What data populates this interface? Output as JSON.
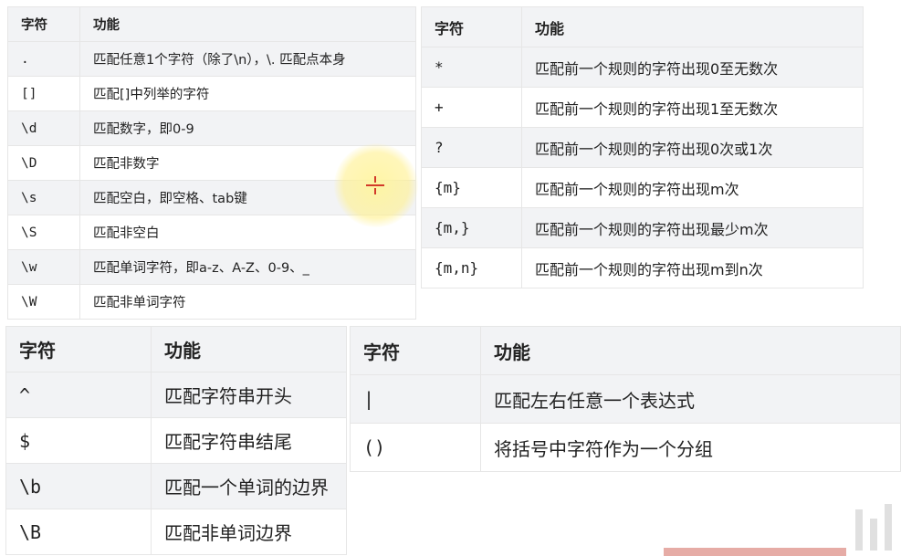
{
  "table_a": {
    "headers": [
      "字符",
      "功能"
    ],
    "rows": [
      {
        "sym": ".",
        "desc": "匹配任意1个字符（除了\\n），\\. 匹配点本身"
      },
      {
        "sym": "[]",
        "desc": "匹配[]中列举的字符"
      },
      {
        "sym": "\\d",
        "desc": "匹配数字，即0-9"
      },
      {
        "sym": "\\D",
        "desc": "匹配非数字"
      },
      {
        "sym": "\\s",
        "desc": "匹配空白，即空格、tab键"
      },
      {
        "sym": "\\S",
        "desc": "匹配非空白"
      },
      {
        "sym": "\\w",
        "desc": "匹配单词字符，即a-z、A-Z、0-9、_"
      },
      {
        "sym": "\\W",
        "desc": "匹配非单词字符"
      }
    ]
  },
  "table_b": {
    "headers": [
      "字符",
      "功能"
    ],
    "rows": [
      {
        "sym": "*",
        "desc": "匹配前一个规则的字符出现0至无数次"
      },
      {
        "sym": "+",
        "desc": "匹配前一个规则的字符出现1至无数次"
      },
      {
        "sym": "?",
        "desc": "匹配前一个规则的字符出现0次或1次"
      },
      {
        "sym": "{m}",
        "desc": "匹配前一个规则的字符出现m次"
      },
      {
        "sym": "{m,}",
        "desc": "匹配前一个规则的字符出现最少m次"
      },
      {
        "sym": "{m,n}",
        "desc": "匹配前一个规则的字符出现m到n次"
      }
    ]
  },
  "table_c": {
    "headers": [
      "字符",
      "功能"
    ],
    "rows": [
      {
        "sym": "^",
        "desc": "匹配字符串开头"
      },
      {
        "sym": "$",
        "desc": "匹配字符串结尾"
      },
      {
        "sym": "\\b",
        "desc": "匹配一个单词的边界"
      },
      {
        "sym": "\\B",
        "desc": "匹配非单词边界"
      }
    ]
  },
  "table_d": {
    "headers": [
      "字符",
      "功能"
    ],
    "rows": [
      {
        "sym": "|",
        "desc": "匹配左右任意一个表达式"
      },
      {
        "sym": "()",
        "desc": "将括号中字符作为一个分组"
      }
    ]
  },
  "cursor": {
    "icon": "crosshair-cursor-icon",
    "color": "#d23a2a",
    "halo": "#fff3a0"
  }
}
